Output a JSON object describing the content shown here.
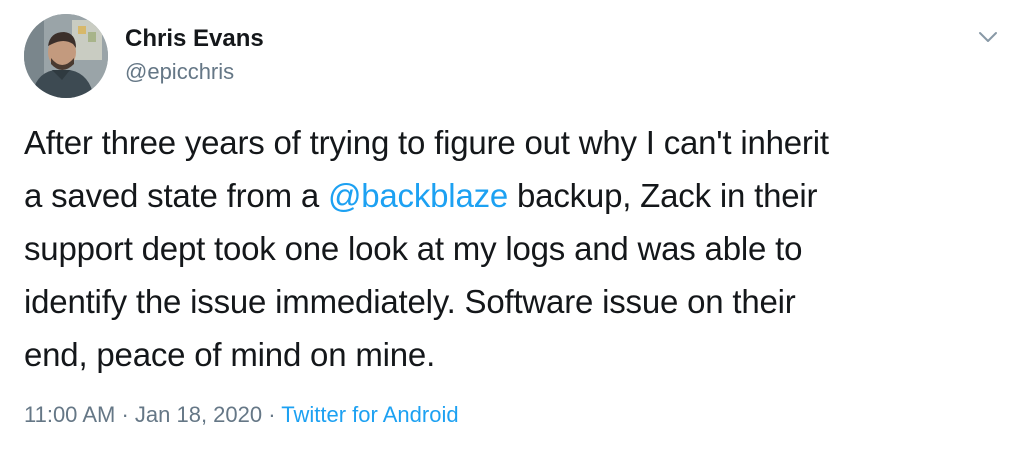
{
  "author": {
    "display_name": "Chris Evans",
    "handle": "@epicchris"
  },
  "tweet": {
    "line1": "After three years of trying to figure out why I can't inherit",
    "line2_before": "a saved state from a ",
    "mention": "@backblaze",
    "line2_after": " backup, Zack in their",
    "line3": "support dept took one look at my logs and was able to",
    "line4": "identify the issue immediately. Software issue on their",
    "line5": "end, peace of mind on mine."
  },
  "meta": {
    "time": "11:00 AM",
    "sep1": " · ",
    "date": "Jan 18, 2020",
    "sep2": " · ",
    "source": "Twitter for Android"
  },
  "colors": {
    "text": "#14171a",
    "secondary": "#657786",
    "accent": "#1da1f2"
  },
  "icons": {
    "menu": "chevron-down-icon"
  }
}
